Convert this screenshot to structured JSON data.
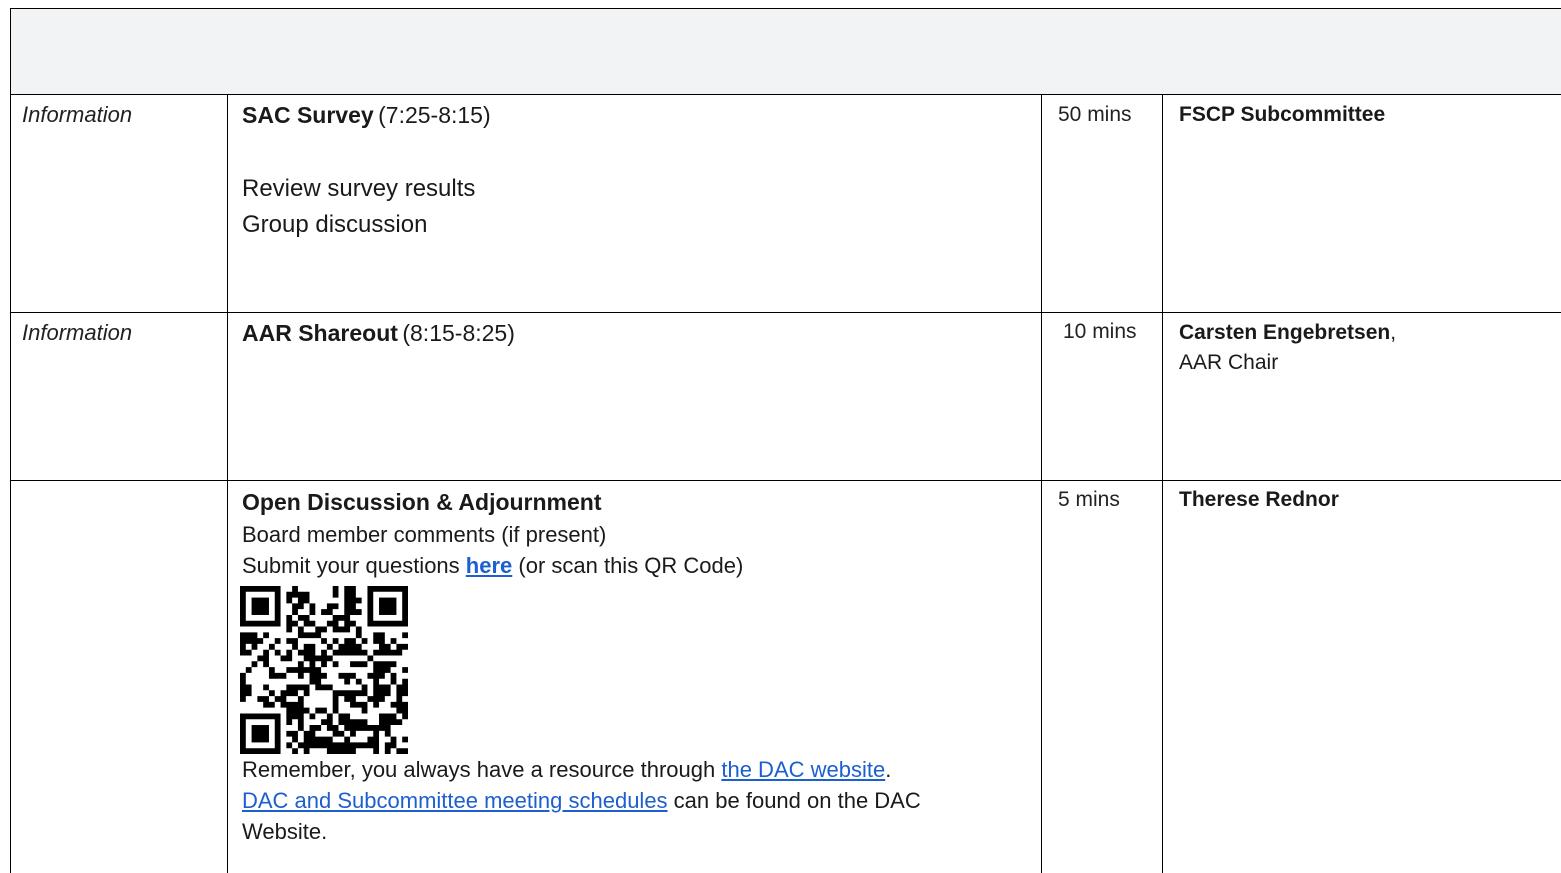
{
  "rows": [
    {
      "type": "Information",
      "title": "SAC Survey",
      "time": "(7:25-8:15)",
      "details": [
        "Review survey results",
        "Group discussion"
      ],
      "duration": "50 mins",
      "presenter": "FSCP Subcommittee",
      "presenter_role": ""
    },
    {
      "type": "Information",
      "title": "AAR Shareout",
      "time": "(8:15-8:25)",
      "details": [],
      "duration": "10 mins",
      "presenter": "Carsten Engebretsen",
      "presenter_suffix": ",",
      "presenter_role": "AAR Chair"
    },
    {
      "type": "",
      "title": "Open Discussion & Adjournment",
      "line1": "Board member comments (if present)",
      "line2_pre": "Submit your questions ",
      "line2_link": "here",
      "line2_post": " (or scan this QR Code)",
      "line3_pre": "Remember, you always have a resource through ",
      "line3_link": "the DAC website",
      "line3_post": ".",
      "line4_link": "DAC and Subcommittee meeting schedules",
      "line4_post": " can be found on the DAC",
      "line5": "Website.",
      "duration": "5 mins",
      "presenter": "Therese Rednor"
    }
  ],
  "colors": {
    "link": "#1d5fcf",
    "header_band": "#f2f3f4"
  },
  "icons": {
    "qr": "qr-code-icon"
  }
}
